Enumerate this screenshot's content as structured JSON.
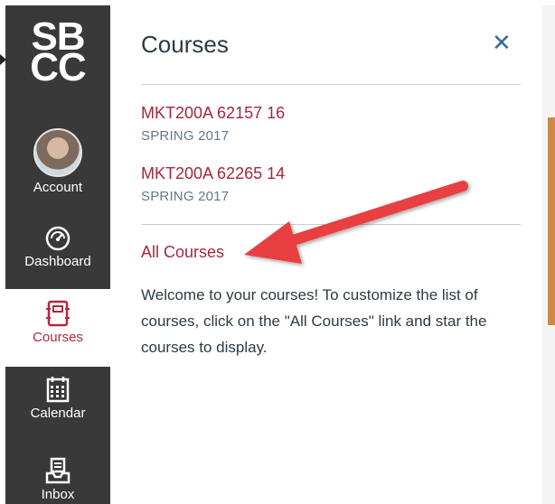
{
  "logo": {
    "line1": "SB",
    "line2": "CC"
  },
  "nav": {
    "account": "Account",
    "dashboard": "Dashboard",
    "courses": "Courses",
    "calendar": "Calendar",
    "inbox": "Inbox"
  },
  "tray": {
    "title": "Courses",
    "close_glyph": "✕",
    "courses": [
      {
        "name": "MKT200A 62157 16",
        "term": "SPRING 2017"
      },
      {
        "name": "MKT200A 62265 14",
        "term": "SPRING 2017"
      }
    ],
    "all_courses_link": "All Courses",
    "welcome_text": "Welcome to your courses! To customize the list of courses, click on the \"All Courses\" link and star the courses to display."
  },
  "colors": {
    "nav_bg": "#393939",
    "link_red": "#a5273b",
    "term_blue": "#5d7a92",
    "annotation_arrow": "#e8413f"
  },
  "icons": [
    "account-avatar",
    "dashboard-gauge-icon",
    "courses-book-icon",
    "calendar-icon",
    "inbox-icon",
    "close-icon",
    "annotation-arrow"
  ]
}
